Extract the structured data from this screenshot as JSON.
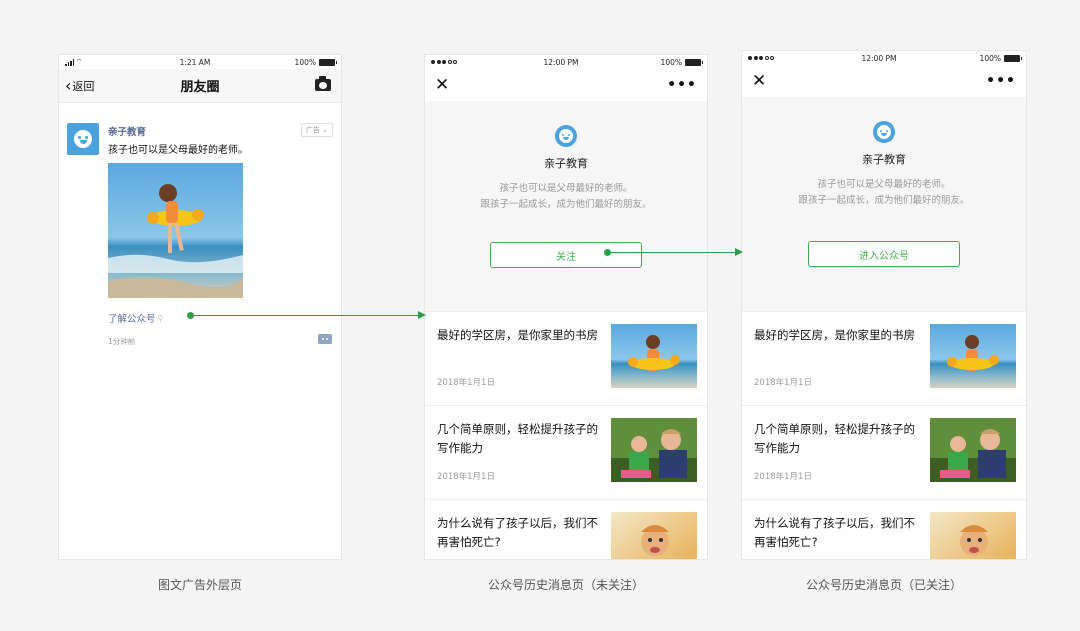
{
  "phone1": {
    "status": {
      "time": "1:21 AM",
      "battery": "100%"
    },
    "nav": {
      "back": "返回",
      "title": "朋友圈"
    },
    "post": {
      "name": "亲子教育",
      "ad_tag": "广告 ⌄",
      "desc": "孩子也可以是父母最好的老师。",
      "link": "了解公众号",
      "ago": "1分钟前"
    }
  },
  "phone2": {
    "status": {
      "time": "12:00 PM",
      "battery": "100%"
    },
    "header": {
      "name": "亲子教育",
      "desc1": "孩子也可以是父母最好的老师。",
      "desc2": "跟孩子一起成长，成为他们最好的朋友。",
      "button": "关注"
    },
    "articles": [
      {
        "title": "最好的学区房，是你家里的书房",
        "date": "2018年1月1日"
      },
      {
        "title": "几个简单原则，轻松提升孩子的写作能力",
        "date": "2018年1月1日"
      },
      {
        "title": "为什么说有了孩子以后，我们不再害怕死亡?",
        "date": ""
      }
    ]
  },
  "phone3": {
    "status": {
      "time": "12:00 PM",
      "battery": "100%"
    },
    "header": {
      "name": "亲子教育",
      "desc1": "孩子也可以是父母最好的老师。",
      "desc2": "跟孩子一起成长，成为他们最好的朋友。",
      "button": "进入公众号"
    },
    "articles": [
      {
        "title": "最好的学区房，是你家里的书房",
        "date": "2018年1月1日"
      },
      {
        "title": "几个简单原则，轻松提升孩子的写作能力",
        "date": "2018年1月1日"
      },
      {
        "title": "为什么说有了孩子以后，我们不再害怕死亡?",
        "date": ""
      }
    ]
  },
  "captions": {
    "c1": "图文广告外层页",
    "c2": "公众号历史消息页（未关注）",
    "c3": "公众号历史消息页（已关注）"
  },
  "colors": {
    "accent": "#2c9f45",
    "link": "#576b95",
    "brand_blue": "#4aa3df"
  }
}
